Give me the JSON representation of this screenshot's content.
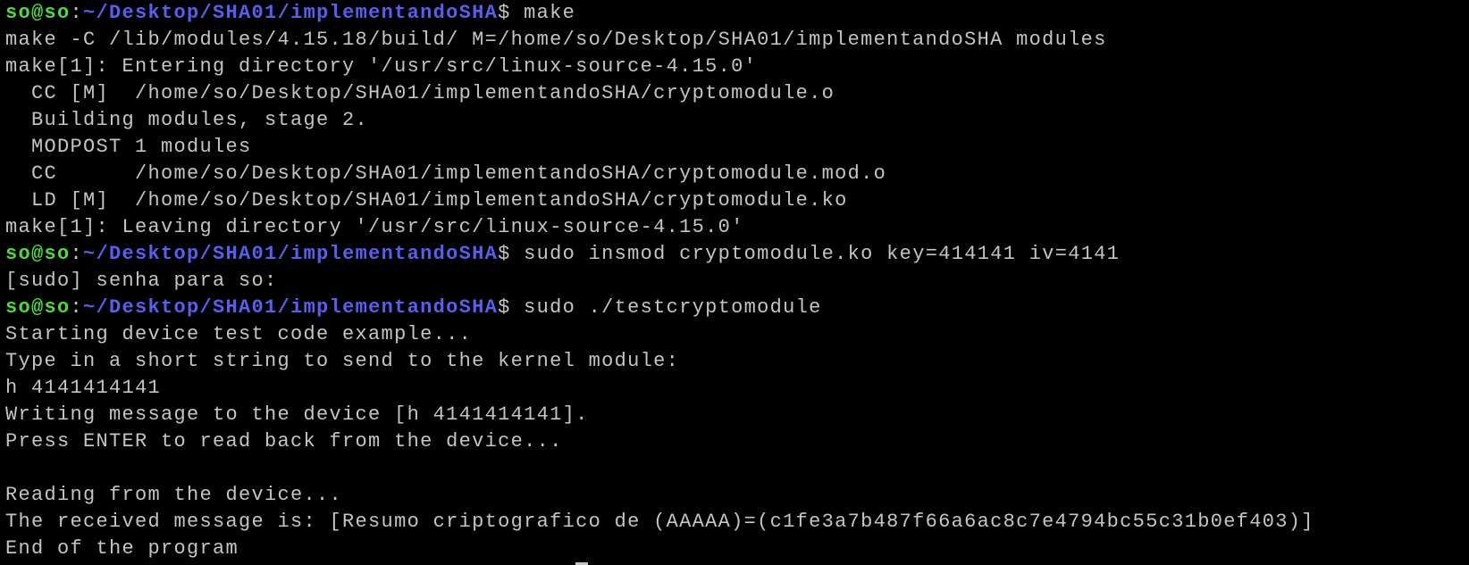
{
  "terminal": {
    "prompt": {
      "user_host": "so@so",
      "separator": ":",
      "path": "~/Desktop/SHA01/implementandoSHA",
      "dollar": "$ "
    },
    "lines": [
      {
        "type": "prompt",
        "command": "make"
      },
      {
        "type": "output",
        "text": "make -C /lib/modules/4.15.18/build/ M=/home/so/Desktop/SHA01/implementandoSHA modules"
      },
      {
        "type": "output",
        "text": "make[1]: Entering directory '/usr/src/linux-source-4.15.0'"
      },
      {
        "type": "output",
        "text": "  CC [M]  /home/so/Desktop/SHA01/implementandoSHA/cryptomodule.o"
      },
      {
        "type": "output",
        "text": "  Building modules, stage 2."
      },
      {
        "type": "output",
        "text": "  MODPOST 1 modules"
      },
      {
        "type": "output",
        "text": "  CC      /home/so/Desktop/SHA01/implementandoSHA/cryptomodule.mod.o"
      },
      {
        "type": "output",
        "text": "  LD [M]  /home/so/Desktop/SHA01/implementandoSHA/cryptomodule.ko"
      },
      {
        "type": "output",
        "text": "make[1]: Leaving directory '/usr/src/linux-source-4.15.0'"
      },
      {
        "type": "prompt",
        "command": "sudo insmod cryptomodule.ko key=414141 iv=4141"
      },
      {
        "type": "output",
        "text": "[sudo] senha para so:"
      },
      {
        "type": "prompt",
        "command": "sudo ./testcryptomodule"
      },
      {
        "type": "output",
        "text": "Starting device test code example..."
      },
      {
        "type": "output",
        "text": "Type in a short string to send to the kernel module:"
      },
      {
        "type": "output",
        "text": "h 4141414141"
      },
      {
        "type": "output",
        "text": "Writing message to the device [h 4141414141]."
      },
      {
        "type": "output",
        "text": "Press ENTER to read back from the device..."
      },
      {
        "type": "output",
        "text": ""
      },
      {
        "type": "output",
        "text": "Reading from the device..."
      },
      {
        "type": "output",
        "text": "The received message is: [Resumo criptografico de (AAAAA)=(c1fe3a7b487f66a6ac8c7e4794bc55c31b0ef403)]"
      },
      {
        "type": "output",
        "text": "End of the program"
      }
    ]
  },
  "colors": {
    "background": "#000000",
    "foreground": "#c4c4c4",
    "prompt_user": "#4bdc3c",
    "prompt_path": "#5560f0"
  }
}
